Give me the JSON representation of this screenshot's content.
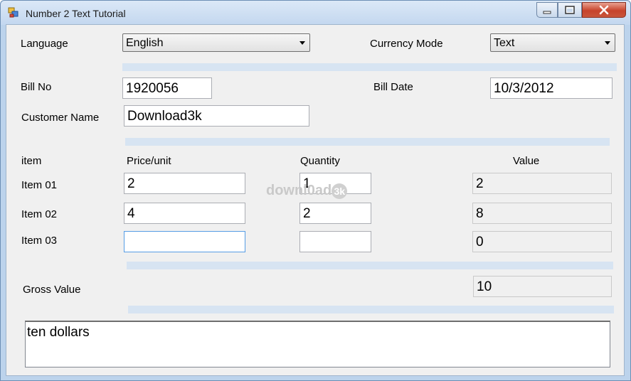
{
  "window": {
    "title": "Number 2 Text Tutorial"
  },
  "language": {
    "label": "Language",
    "value": "English"
  },
  "currency_mode": {
    "label": "Currency Mode",
    "value": "Text"
  },
  "bill": {
    "no_label": "Bill No",
    "no_value": "1920056",
    "date_label": "Bill Date",
    "date_value": "10/3/2012",
    "customer_label": "Customer Name",
    "customer_value": "Download3k"
  },
  "table": {
    "headers": {
      "item": "item",
      "price": "Price/unit",
      "quantity": "Quantity",
      "value": "Value"
    },
    "rows": [
      {
        "item": "Item 01",
        "price": "2",
        "quantity": "1",
        "value": "2"
      },
      {
        "item": "Item 02",
        "price": "4",
        "quantity": "2",
        "value": "8"
      },
      {
        "item": "Item 03",
        "price": "",
        "quantity": "",
        "value": "0"
      }
    ]
  },
  "gross": {
    "label": "Gross Value",
    "value": "10"
  },
  "result_text": "ten dollars",
  "watermark": {
    "text": "downl0ad",
    "badge": "3k"
  }
}
